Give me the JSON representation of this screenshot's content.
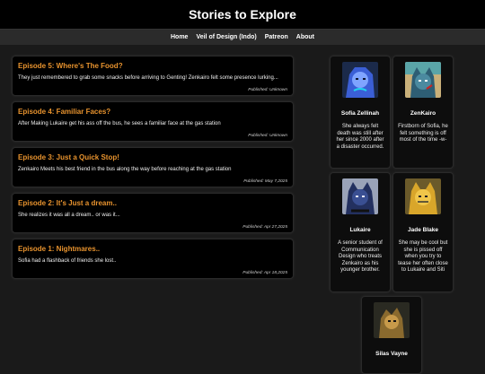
{
  "site": {
    "title": "Stories to Explore"
  },
  "nav": [
    {
      "label": "Home"
    },
    {
      "label": "Veil of Design (Indo)"
    },
    {
      "label": "Patreon"
    },
    {
      "label": "About"
    }
  ],
  "episodes": [
    {
      "title": "Episode 5: Where's The Food?",
      "desc": "They just remembered to grab some snacks before arriving to Genting! Zenkairo felt some presence lurking...",
      "published": "Published: Unknown"
    },
    {
      "title": "Episode 4: Familiar Faces?",
      "desc": "After Making Lukaire get his ass off the bus, he sees a familiar face at the gas station",
      "published": "Published: Unknown"
    },
    {
      "title": "Episode 3: Just a Quick Stop!",
      "desc": "Zenkairo Meets his best friend in the bus along the way before reaching at the gas station",
      "published": "Published: May 7,2025"
    },
    {
      "title": "Episode 2: It's Just a dream..",
      "desc": "She realizes it was all a dream.. or was it...",
      "published": "Published: Apr 27,2025"
    },
    {
      "title": "Episode 1: Nightmares..",
      "desc": "Sofia had a flashback of friends she lost..",
      "published": "Published: Apr 18,2025"
    }
  ],
  "characters": [
    {
      "name": "Sofia Zellinah",
      "desc": "She always felt death was still after her since 2000 after a disaster occurred.",
      "color": "#3b5fd6"
    },
    {
      "name": "ZenKairo",
      "desc": "Firstborn of Sofia, he felt something is off most of the time -w-",
      "color": "#3a7f86"
    },
    {
      "name": "Lukaire",
      "desc": "A senior student of Communication Design who treats Zenkairo as his younger brother.",
      "color": "#2f3f78"
    },
    {
      "name": "Jade Blake",
      "desc": "She may be cool but she is pissed off when you try to tease her often close to Lukaire and Siti",
      "color": "#d9a62a"
    },
    {
      "name": "Silas Vayne",
      "desc": "",
      "color": "#8a6a2e"
    }
  ]
}
